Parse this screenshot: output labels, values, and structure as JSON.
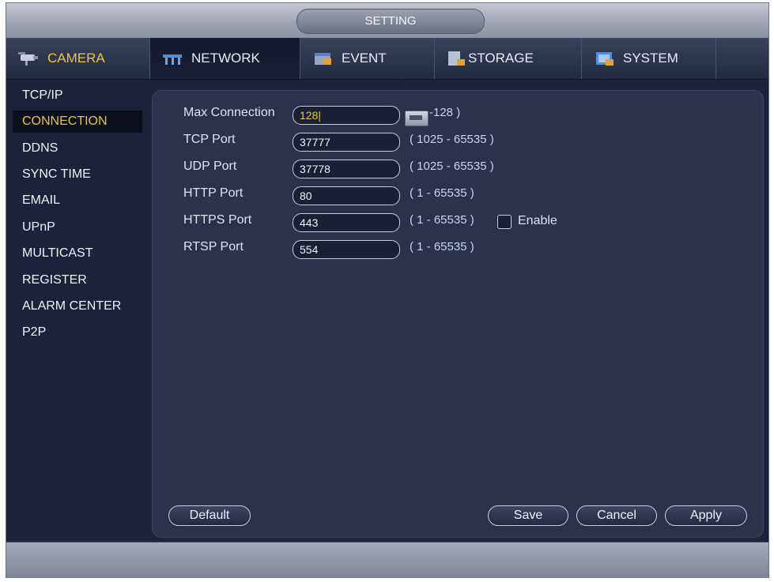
{
  "window": {
    "title": "SETTING"
  },
  "tabs": [
    {
      "label": "CAMERA",
      "icon": "camera-icon"
    },
    {
      "label": "NETWORK",
      "icon": "network-icon"
    },
    {
      "label": "EVENT",
      "icon": "event-icon"
    },
    {
      "label": "STORAGE",
      "icon": "storage-icon"
    },
    {
      "label": "SYSTEM",
      "icon": "system-icon"
    }
  ],
  "sidebar": {
    "items": [
      "TCP/IP",
      "CONNECTION",
      "DDNS",
      "SYNC TIME",
      "EMAIL",
      "UPnP",
      "MULTICAST",
      "REGISTER",
      "ALARM CENTER",
      "P2P"
    ],
    "selected": "CONNECTION"
  },
  "form": {
    "max_connection": {
      "label": "Max Connection",
      "value": "128|",
      "range": "-128 )"
    },
    "tcp_port": {
      "label": "TCP Port",
      "value": "37777",
      "range": "( 1025 - 65535 )"
    },
    "udp_port": {
      "label": "UDP Port",
      "value": "37778",
      "range": "( 1025 - 65535 )"
    },
    "http_port": {
      "label": "HTTP Port",
      "value": "80",
      "range": "( 1 - 65535 )"
    },
    "https_port": {
      "label": "HTTPS Port",
      "value": "443",
      "range": "( 1 - 65535 )",
      "enable_label": "Enable",
      "enabled": false
    },
    "rtsp_port": {
      "label": "RTSP Port",
      "value": "554",
      "range": "( 1 - 65535 )"
    }
  },
  "buttons": {
    "default": "Default",
    "save": "Save",
    "cancel": "Cancel",
    "apply": "Apply"
  },
  "colors": {
    "accent": "#e8c640",
    "background": "#1c2338",
    "panel": "#2b3249",
    "range_text": "#c7d3f2"
  }
}
